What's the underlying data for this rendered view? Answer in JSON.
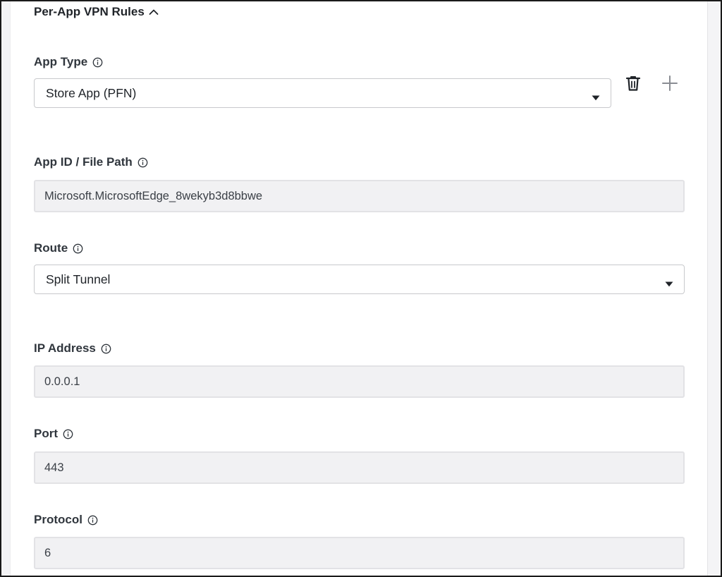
{
  "section": {
    "title": "Per-App VPN Rules",
    "expanded": true
  },
  "fields": {
    "app_type": {
      "label": "App Type",
      "value": "Store App (PFN)"
    },
    "app_id": {
      "label": "App ID / File Path",
      "value": "Microsoft.MicrosoftEdge_8wekyb3d8bbwe"
    },
    "route": {
      "label": "Route",
      "value": "Split Tunnel"
    },
    "ip_address": {
      "label": "IP Address",
      "value": "0.0.0.1"
    },
    "port": {
      "label": "Port",
      "value": "443"
    },
    "protocol": {
      "label": "Protocol",
      "value": "6"
    }
  },
  "icons": {
    "info": "info-icon",
    "collapse": "chevron-up-icon",
    "delete": "trash-icon",
    "add": "plus-icon",
    "dropdown": "caret-down-icon"
  },
  "colors": {
    "text": "#1f2328",
    "label": "#30363d",
    "readonly_bg": "#f1f1f3",
    "border": "#c8c9cc",
    "add_icon": "#8a8d93"
  }
}
